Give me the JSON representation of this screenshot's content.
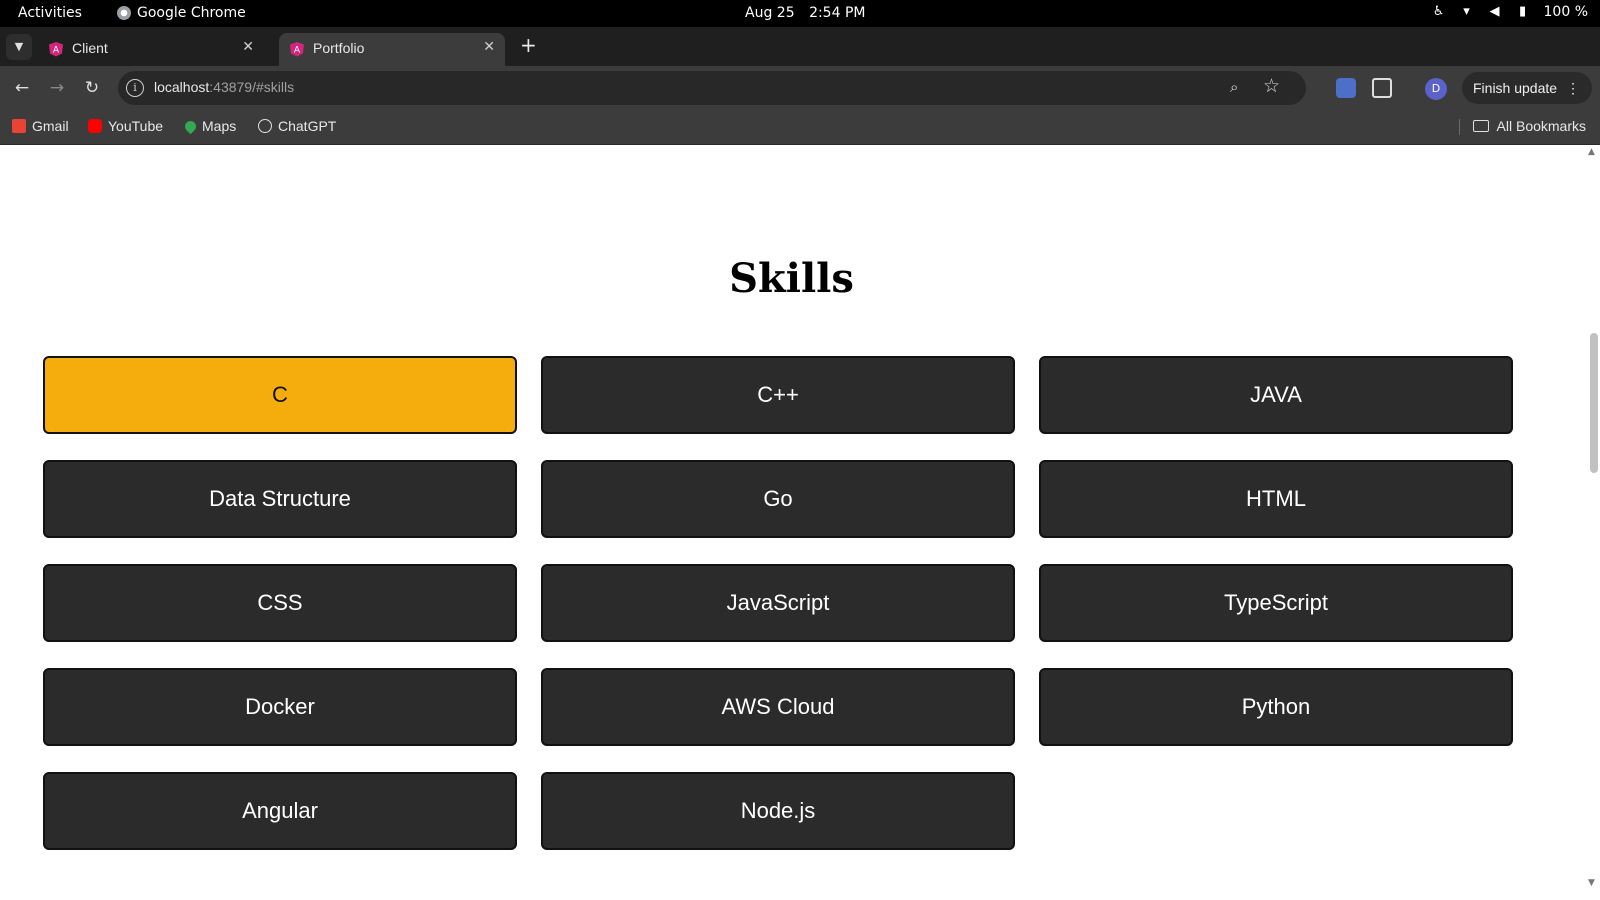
{
  "system": {
    "activities": "Activities",
    "app_name": "Google Chrome",
    "date": "Aug 25",
    "time": "2:54 PM",
    "battery": "100 %"
  },
  "tabs": [
    {
      "title": "Client"
    },
    {
      "title": "Portfolio"
    }
  ],
  "toolbar": {
    "url_host": "localhost",
    "url_rest": ":43879/#skills",
    "finish_update": "Finish update",
    "avatar_initial": "D"
  },
  "bookmarks": [
    {
      "label": "Gmail",
      "icon": "gmail-icon",
      "color": "#ea4335"
    },
    {
      "label": "YouTube",
      "icon": "youtube-icon",
      "color": "#ff0000"
    },
    {
      "label": "Maps",
      "icon": "maps-icon",
      "color": "#34a853"
    },
    {
      "label": "ChatGPT",
      "icon": "chatgpt-icon",
      "color": "#e0e0e0"
    }
  ],
  "all_bookmarks": "All Bookmarks",
  "page": {
    "heading": "Skills",
    "skills": [
      "C",
      "C++",
      "JAVA",
      "Data Structure",
      "Go",
      "HTML",
      "CSS",
      "JavaScript",
      "TypeScript",
      "Docker",
      "AWS Cloud",
      "Python",
      "Angular",
      "Node.js"
    ],
    "active_skill": "C",
    "accent_color": "#f5ad0e",
    "card_color": "#2b2b2b"
  }
}
